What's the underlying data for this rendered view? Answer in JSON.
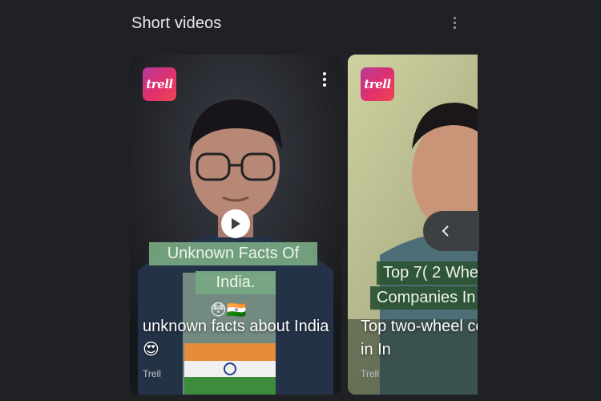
{
  "section": {
    "title": "Short videos",
    "menu_icon": "more-vert-icon"
  },
  "cards": [
    {
      "brand": "trell",
      "banner_line1": "Unknown Facts Of",
      "banner_line2": "India.",
      "banner_emoji": "😳🇮🇳",
      "title": "unknown facts about India 😍",
      "source": "Trell"
    },
    {
      "brand": "trell",
      "banner_line1": "Top 7( 2 Whe",
      "banner_line2": "Companies In",
      "title": "Top two-wheel companies in In",
      "source": "Trell"
    }
  ],
  "colors": {
    "background": "#202124",
    "text": "#e8eaed",
    "subtext": "#bdc1c6",
    "brand_gradient_start": "#b43a9c",
    "brand_gradient_end": "#ef4650"
  }
}
